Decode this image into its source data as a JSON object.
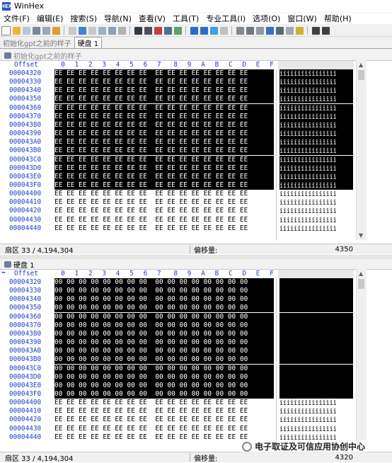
{
  "app": {
    "title": "WinHex"
  },
  "menu": [
    "文件(F)",
    "编辑(E)",
    "搜索(S)",
    "导航(N)",
    "查看(V)",
    "工具(T)",
    "专业工具(I)",
    "选项(O)",
    "窗口(W)",
    "帮助(H)"
  ],
  "tabs": [
    {
      "label": "初始化gpt之前的样子",
      "active": false
    },
    {
      "label": "硬盘 1",
      "active": true
    }
  ],
  "hex_columns": [
    "0",
    "1",
    "2",
    "3",
    "4",
    "5",
    "6",
    "7",
    "8",
    "9",
    "A",
    "B",
    "C",
    "D",
    "E",
    "F"
  ],
  "offset_header": "Offset",
  "panel1": {
    "title": "初始化gpt之前的样子",
    "status_sector": "扇区 33 / 4,194,304",
    "status_offset_label": "偏移量:",
    "status_offset_value": "4350",
    "rows": [
      {
        "offset": "00004320",
        "hex": "EE EE EE EE EE EE EE EE  EE EE EE EE EE EE EE EE",
        "ascii": "îîîîîîîîîîîîîîîî",
        "selected": true
      },
      {
        "offset": "00004330",
        "hex": "EE EE EE EE EE EE EE EE  EE EE EE EE EE EE EE EE",
        "ascii": "îîîîîîîîîîîîîîîî",
        "selected": true
      },
      {
        "offset": "00004340",
        "hex": "EE EE EE EE EE EE EE EE  EE EE EE EE EE EE EE EE",
        "ascii": "îîîîîîîîîîîîîîîî",
        "selected": true
      },
      {
        "offset": "00004350",
        "hex": "EE EE EE EE EE EE EE EE  EE EE EE EE EE EE EE EE",
        "ascii": "îîîîîîîîîîîîîîîî",
        "selected": true
      },
      {
        "offset": "00004360",
        "hex": "EE EE EE EE EE EE EE EE  EE EE EE EE EE EE EE EE",
        "ascii": "îîîîîîîîîîîîîîîî",
        "selected": true
      },
      {
        "offset": "00004370",
        "hex": "EE EE EE EE EE EE EE EE  EE EE EE EE EE EE EE EE",
        "ascii": "îîîîîîîîîîîîîîîî",
        "selected": true
      },
      {
        "offset": "00004380",
        "hex": "EE EE EE EE EE EE EE EE  EE EE EE EE EE EE EE EE",
        "ascii": "îîîîîîîîîîîîîîîî",
        "selected": true
      },
      {
        "offset": "00004390",
        "hex": "EE EE EE EE EE EE EE EE  EE EE EE EE EE EE EE EE",
        "ascii": "îîîîîîîîîîîîîîîî",
        "selected": true
      },
      {
        "offset": "000043A0",
        "hex": "EE EE EE EE EE EE EE EE  EE EE EE EE EE EE EE EE",
        "ascii": "îîîîîîîîîîîîîîîî",
        "selected": true
      },
      {
        "offset": "000043B0",
        "hex": "EE EE EE EE EE EE EE EE  EE EE EE EE EE EE EE EE",
        "ascii": "îîîîîîîîîîîîîîîî",
        "selected": true
      },
      {
        "offset": "000043C0",
        "hex": "EE EE EE EE EE EE EE EE  EE EE EE EE EE EE EE EE",
        "ascii": "îîîîîîîîîîîîîîîî",
        "selected": true
      },
      {
        "offset": "000043D0",
        "hex": "EE EE EE EE EE EE EE EE  EE EE EE EE EE EE EE EE",
        "ascii": "îîîîîîîîîîîîîîîî",
        "selected": true
      },
      {
        "offset": "000043E0",
        "hex": "EE EE EE EE EE EE EE EE  EE EE EE EE EE EE EE EE",
        "ascii": "îîîîîîîîîîîîîîîî",
        "selected": true
      },
      {
        "offset": "000043F0",
        "hex": "EE EE EE EE EE EE EE EE  EE EE EE EE EE EE EE EE",
        "ascii": "îîîîîîîîîîîîîîîî",
        "selected": true
      },
      {
        "offset": "00004400",
        "hex": "EE EE EE EE EE EE EE EE  EE EE EE EE EE EE EE EE",
        "ascii": "îîîîîîîîîîîîîîîî",
        "selected": false
      },
      {
        "offset": "00004410",
        "hex": "EE EE EE EE EE EE EE EE  EE EE EE EE EE EE EE EE",
        "ascii": "îîîîîîîîîîîîîîîî",
        "selected": false
      },
      {
        "offset": "00004420",
        "hex": "EE EE EE EE EE EE EE EE  EE EE EE EE EE EE EE EE",
        "ascii": "îîîîîîîîîîîîîîîî",
        "selected": false
      },
      {
        "offset": "00004430",
        "hex": "EE EE EE EE EE EE EE EE  EE EE EE EE EE EE EE EE",
        "ascii": "îîîîîîîîîîîîîîîî",
        "selected": false
      },
      {
        "offset": "00004440",
        "hex": "EE EE EE EE EE EE EE EE  EE EE EE EE EE EE EE EE",
        "ascii": "îîîîîîîîîîîîîîîî",
        "selected": false
      }
    ]
  },
  "panel2": {
    "title": "硬盘 1",
    "status_sector": "扇区 33 / 4,194,304",
    "status_offset_label": "偏移量:",
    "status_offset_value": "4320",
    "rows": [
      {
        "offset": "00004320",
        "hex": "00 00 00 00 00 00 00 00  00 00 00 00 00 00 00 00",
        "ascii": "",
        "selected": true
      },
      {
        "offset": "00004330",
        "hex": "00 00 00 00 00 00 00 00  00 00 00 00 00 00 00 00",
        "ascii": "",
        "selected": true
      },
      {
        "offset": "00004340",
        "hex": "00 00 00 00 00 00 00 00  00 00 00 00 00 00 00 00",
        "ascii": "",
        "selected": true
      },
      {
        "offset": "00004350",
        "hex": "00 00 00 00 00 00 00 00  00 00 00 00 00 00 00 00",
        "ascii": "",
        "selected": true
      },
      {
        "offset": "00004360",
        "hex": "00 00 00 00 00 00 00 00  00 00 00 00 00 00 00 00",
        "ascii": "",
        "selected": true
      },
      {
        "offset": "00004370",
        "hex": "00 00 00 00 00 00 00 00  00 00 00 00 00 00 00 00",
        "ascii": "",
        "selected": true
      },
      {
        "offset": "00004380",
        "hex": "00 00 00 00 00 00 00 00  00 00 00 00 00 00 00 00",
        "ascii": "",
        "selected": true
      },
      {
        "offset": "00004390",
        "hex": "00 00 00 00 00 00 00 00  00 00 00 00 00 00 00 00",
        "ascii": "",
        "selected": true
      },
      {
        "offset": "000043A0",
        "hex": "00 00 00 00 00 00 00 00  00 00 00 00 00 00 00 00",
        "ascii": "",
        "selected": true
      },
      {
        "offset": "000043B0",
        "hex": "00 00 00 00 00 00 00 00  00 00 00 00 00 00 00 00",
        "ascii": "",
        "selected": true
      },
      {
        "offset": "000043C0",
        "hex": "00 00 00 00 00 00 00 00  00 00 00 00 00 00 00 00",
        "ascii": "",
        "selected": true
      },
      {
        "offset": "000043D0",
        "hex": "00 00 00 00 00 00 00 00  00 00 00 00 00 00 00 00",
        "ascii": "",
        "selected": true
      },
      {
        "offset": "000043E0",
        "hex": "00 00 00 00 00 00 00 00  00 00 00 00 00 00 00 00",
        "ascii": "",
        "selected": true
      },
      {
        "offset": "000043F0",
        "hex": "00 00 00 00 00 00 00 00  00 00 00 00 00 00 00 00",
        "ascii": "",
        "selected": true
      },
      {
        "offset": "00004400",
        "hex": "EE EE EE EE EE EE EE EE  EE EE EE EE EE EE EE EE",
        "ascii": "îîîîîîîîîîîîîîîî",
        "selected": false
      },
      {
        "offset": "00004410",
        "hex": "EE EE EE EE EE EE EE EE  EE EE EE EE EE EE EE EE",
        "ascii": "îîîîîîîîîîîîîîîî",
        "selected": false
      },
      {
        "offset": "00004420",
        "hex": "EE EE EE EE EE EE EE EE  EE EE EE EE EE EE EE EE",
        "ascii": "îîîîîîîîîîîîîîîî",
        "selected": false
      },
      {
        "offset": "00004430",
        "hex": "EE EE EE EE EE EE EE EE  EE EE EE EE EE EE EE EE",
        "ascii": "îîîîîîîîîîîîîîîî",
        "selected": false
      },
      {
        "offset": "00004440",
        "hex": "EE EE EE EE EE EE EE EE  EE EE EE EE EE EE EE EE",
        "ascii": "îîîîîîîîîîîîîîîî",
        "selected": false
      }
    ]
  },
  "watermark": "电子取证及可信应用协创中心",
  "colors": {
    "offset_blue": "#1f44c8",
    "selection": "#000000"
  }
}
